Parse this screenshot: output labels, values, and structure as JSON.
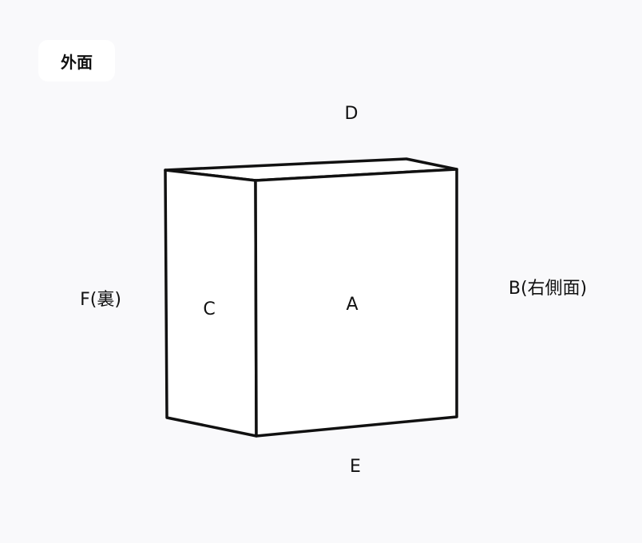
{
  "badge": {
    "label": "外面"
  },
  "labels": {
    "top": "D",
    "front": "A",
    "side": "C",
    "right": "B(右側面)",
    "left": "F(裏)",
    "bottom": "E"
  },
  "colors": {
    "background": "#f9f9fb",
    "stroke": "#111111",
    "face_fill": "#ffffff"
  }
}
